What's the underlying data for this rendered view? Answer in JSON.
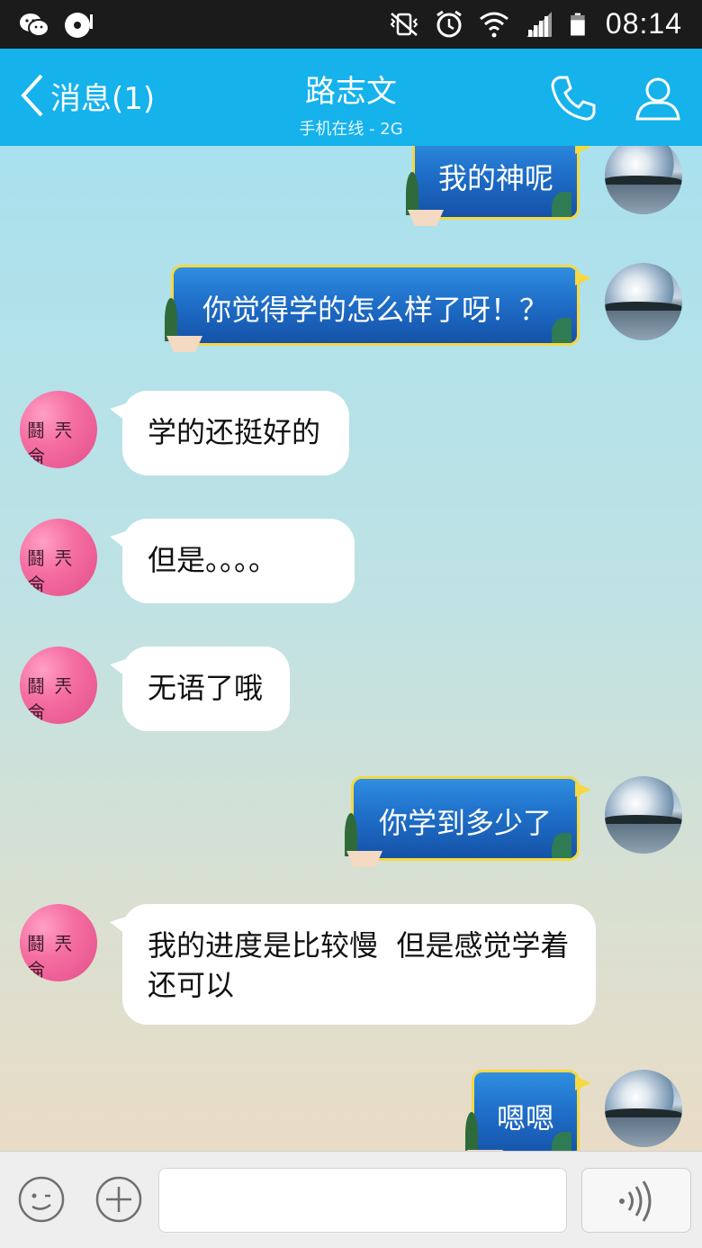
{
  "status_bar": {
    "time": "08:14"
  },
  "header": {
    "back_label": "消息(1)",
    "title": "路志文",
    "subtitle": "手机在线 - 2G",
    "bg_color": "#15b2ec"
  },
  "messages": [
    {
      "side": "out",
      "text": "我的神呢"
    },
    {
      "side": "out",
      "text": "你觉得学的怎么样了呀！？"
    },
    {
      "side": "in",
      "text": "学的还挺好的"
    },
    {
      "side": "in",
      "text": "但是。。。。"
    },
    {
      "side": "in",
      "text": "无语了哦"
    },
    {
      "side": "out",
      "text": "你学到多少了"
    },
    {
      "side": "in",
      "text": "我的进度是比较慢  但是感觉学着还可以"
    },
    {
      "side": "out",
      "text": "嗯嗯"
    }
  ],
  "icons": {
    "wechat": "wechat-icon",
    "music": "music-icon",
    "mute": "vibrate-mute-icon",
    "alarm": "alarm-icon",
    "wifi": "wifi-icon",
    "signal": "signal-icon",
    "battery": "battery-icon",
    "phone": "phone-icon",
    "profile": "profile-icon",
    "emoji": "emoji-icon",
    "plus": "plus-icon",
    "voice": "voice-icon"
  }
}
